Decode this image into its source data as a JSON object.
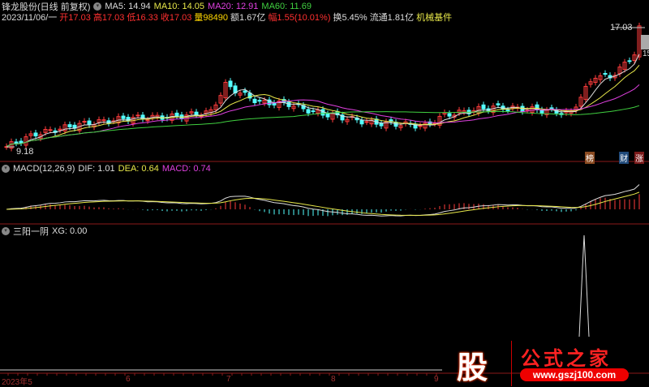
{
  "header": {
    "title": "锋龙股份(日线 前复权)",
    "ma": [
      {
        "label": "MA5: 14.94",
        "color": "#dddddd"
      },
      {
        "label": "MA10: 14.05",
        "color": "#e8e84a"
      },
      {
        "label": "MA20: 12.91",
        "color": "#e040e0"
      },
      {
        "label": "MA60: 11.69",
        "color": "#40d040"
      }
    ],
    "info": {
      "date": "2023/11/06/一",
      "open": "开17.03",
      "high": "高17.03",
      "low": "低16.33",
      "close": "收17.03",
      "volume": "量98490",
      "amount": "额1.67亿",
      "change": "幅1.55(10.01%)",
      "turnover": "换5.45%",
      "float": "流通1.81亿",
      "sector": "机械基件"
    }
  },
  "price_chart": {
    "high_label": "17.03",
    "low_label": "9.18",
    "right_cut_label": "15",
    "tags": [
      "榜",
      "财",
      "涨"
    ]
  },
  "macd": {
    "title": "MACD(12,26,9)",
    "dif": "DIF: 1.01",
    "dea": "DEA: 0.64",
    "macd": "MACD: 0.74"
  },
  "indicator": {
    "title": "三阳一阴",
    "xg": "XG: 0.00"
  },
  "x_axis": [
    "2023年5",
    "6",
    "7",
    "8",
    "9"
  ],
  "watermark": {
    "char": "股",
    "name": "公式之家",
    "url": "www.gszj100.com"
  },
  "chart_data": {
    "type": "candlestick",
    "price_range": [
      9.18,
      17.03
    ],
    "keypoints": [
      [
        0,
        9.4
      ],
      [
        6,
        10.2
      ],
      [
        15,
        10.8
      ],
      [
        25,
        11.2
      ],
      [
        35,
        11.3
      ],
      [
        42,
        11.6
      ],
      [
        45,
        13.3
      ],
      [
        48,
        12.8
      ],
      [
        52,
        12.2
      ],
      [
        58,
        12.1
      ],
      [
        63,
        11.6
      ],
      [
        68,
        11.3
      ],
      [
        75,
        10.9
      ],
      [
        82,
        10.8
      ],
      [
        86,
        10.7
      ],
      [
        90,
        11.4
      ],
      [
        100,
        11.9
      ],
      [
        110,
        11.7
      ],
      [
        116,
        11.5
      ],
      [
        118,
        12.6
      ],
      [
        121,
        13.9
      ],
      [
        124,
        13.8
      ],
      [
        127,
        14.6
      ],
      [
        129,
        15.3
      ],
      [
        130,
        17.03
      ]
    ]
  }
}
